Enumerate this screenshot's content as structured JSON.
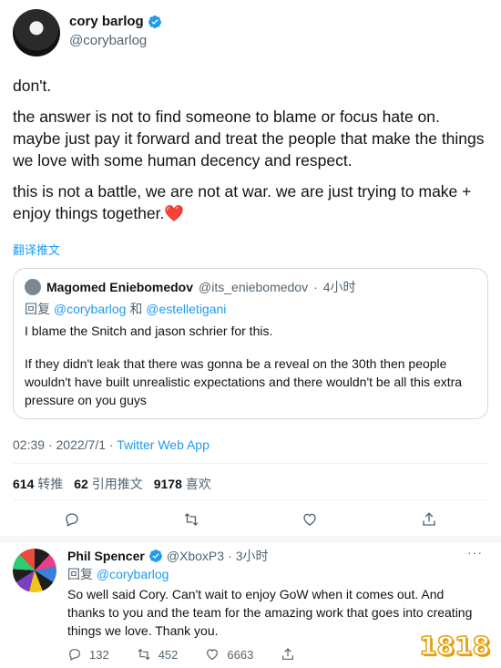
{
  "tweet": {
    "author_name": "cory barlog",
    "author_handle": "@corybarlog",
    "paragraphs": [
      "don't.",
      "the answer is not to find someone to blame or focus hate on. maybe just pay it forward and treat the people that make the things we love with some human decency and respect.",
      "this is not a battle, we are not at war. we are just trying to make + enjoy things together."
    ],
    "heart_emoji": "❤️",
    "translate_label": "翻译推文"
  },
  "quote": {
    "author_name": "Magomed Eniebomedov",
    "author_handle": "@its_eniebomedov",
    "separator": "·",
    "time": "4小时",
    "reply_prefix": "回复",
    "reply_to_1": "@corybarlog",
    "reply_and": "和",
    "reply_to_2": "@estelletigani",
    "paragraphs": [
      "I blame the Snitch and jason schrier for this.",
      "If they didn't leak that there was gonna be a reveal on the 30th then people wouldn't have built unrealistic expectations and there wouldn't be all this extra pressure on you guys"
    ]
  },
  "meta": {
    "time": "02:39",
    "separator1": "·",
    "date": "2022/7/1",
    "separator2": "·",
    "source": "Twitter Web App"
  },
  "stats": {
    "retweets_count": "614",
    "retweets_label": "转推",
    "quotes_count": "62",
    "quotes_label": "引用推文",
    "likes_count": "9178",
    "likes_label": "喜欢"
  },
  "reply": {
    "author_name": "Phil Spencer",
    "author_handle": "@XboxP3",
    "separator": "·",
    "time": "3小时",
    "more": "···",
    "reply_prefix": "回复",
    "reply_to": "@corybarlog",
    "text": "So well said Cory. Can't wait to enjoy GoW when it comes out. And thanks to you and the team for the amazing work that goes into creating things we love. Thank you.",
    "replies": "132",
    "retweets": "452",
    "likes": "6663"
  },
  "watermark": "1818",
  "colors": {
    "accent": "#1d9bf0",
    "text": "#0f1419",
    "secondary": "#536471",
    "heart": "#e0245e",
    "watermark": "#e4a00f"
  },
  "icons": [
    "verified-icon",
    "reply-icon",
    "retweet-icon",
    "like-icon",
    "share-icon",
    "more-icon"
  ]
}
